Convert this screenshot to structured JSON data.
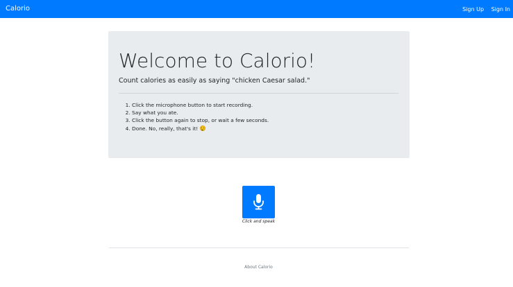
{
  "navbar": {
    "brand": "Calorio",
    "links": [
      "Sign Up",
      "Sign In"
    ]
  },
  "jumbotron": {
    "title": "Welcome to Calorio!",
    "lead": "Count calories as easily as saying \"chicken Caesar salad.\"",
    "steps": [
      "Click the microphone button to start recording.",
      "Say what you ate.",
      "Click the button again to stop, or wait a few seconds.",
      "Done. No, really, that's it!"
    ]
  },
  "mic": {
    "icon": "microphone-icon",
    "caption": "Click and speak"
  },
  "footer": {
    "link": "About Calorio"
  },
  "colors": {
    "primary": "#007bff",
    "jumbotron_bg": "#e9ecef",
    "muted": "#6c757d"
  }
}
